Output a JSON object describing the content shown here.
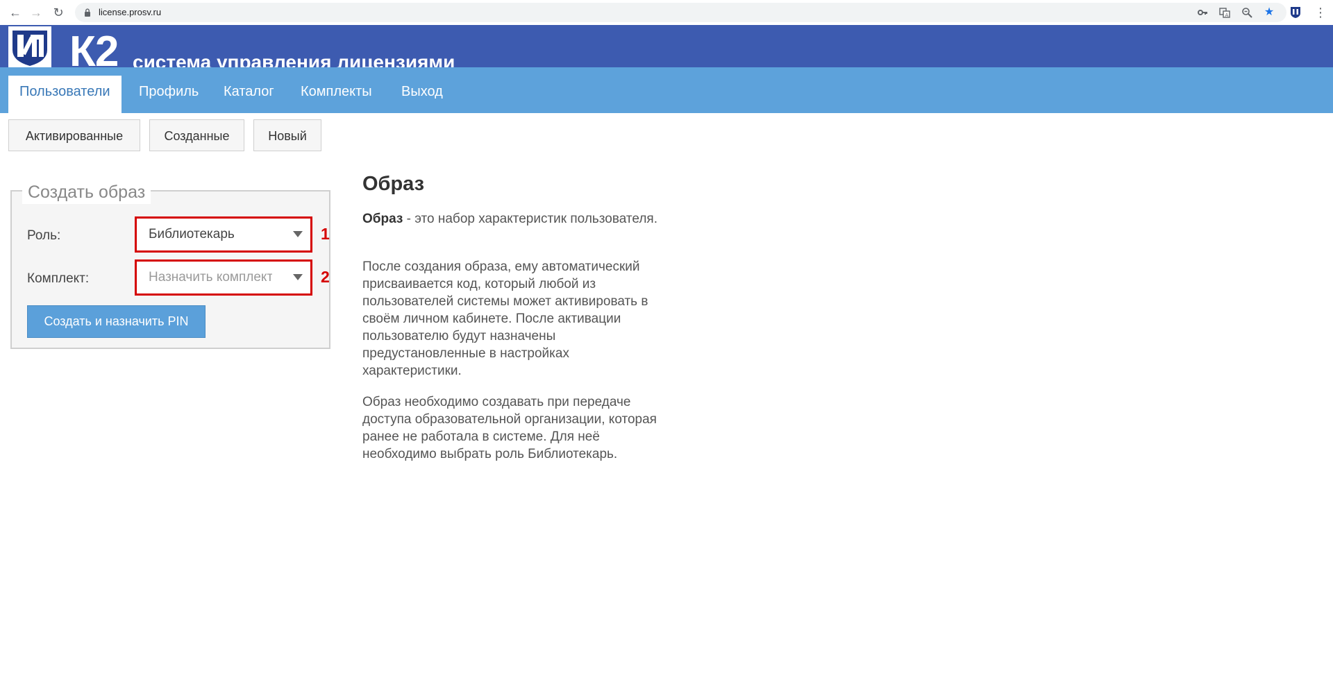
{
  "browser": {
    "url": "license.prosv.ru",
    "back_icon": "back-arrow-icon",
    "forward_icon": "forward-arrow-icon",
    "reload_icon": "reload-icon"
  },
  "header": {
    "logo_icon": "prosveshchenie-logo",
    "title": "К2",
    "subtitle": "система управления лицензиями",
    "background_color": "#3d5bb0"
  },
  "main_nav": {
    "items": [
      {
        "label": "Пользователи",
        "active": true
      },
      {
        "label": "Профиль"
      },
      {
        "label": "Каталог"
      },
      {
        "label": "Комплекты"
      },
      {
        "label": "Выход"
      }
    ],
    "background_color": "#5da2db"
  },
  "sub_tabs": [
    {
      "label": "Активированные"
    },
    {
      "label": "Созданные"
    },
    {
      "label": "Новый"
    }
  ],
  "form": {
    "legend": "Создать образ",
    "role_label": "Роль:",
    "role_value": "Библиотекарь",
    "kit_label": "Комплект:",
    "kit_placeholder": "Назначить комплект",
    "submit_label": "Создать и назначить PIN",
    "callout_1": "1",
    "callout_2": "2",
    "highlight_color": "#d50000"
  },
  "info": {
    "title": "Образ",
    "p1_bold": "Образ",
    "p1_rest": " - это набор характеристик пользователя.",
    "p2": "После создания образа, ему автоматический присваивается код, который любой из пользователей системы может активировать в своём личном кабинете. После активации пользователю будут назначены предустановленные в настройках характеристики.",
    "p3": "Образ необходимо создавать при передаче доступа образовательной организации, которая ранее не работала в системе. Для неё необходимо выбрать роль Библиотекарь."
  }
}
